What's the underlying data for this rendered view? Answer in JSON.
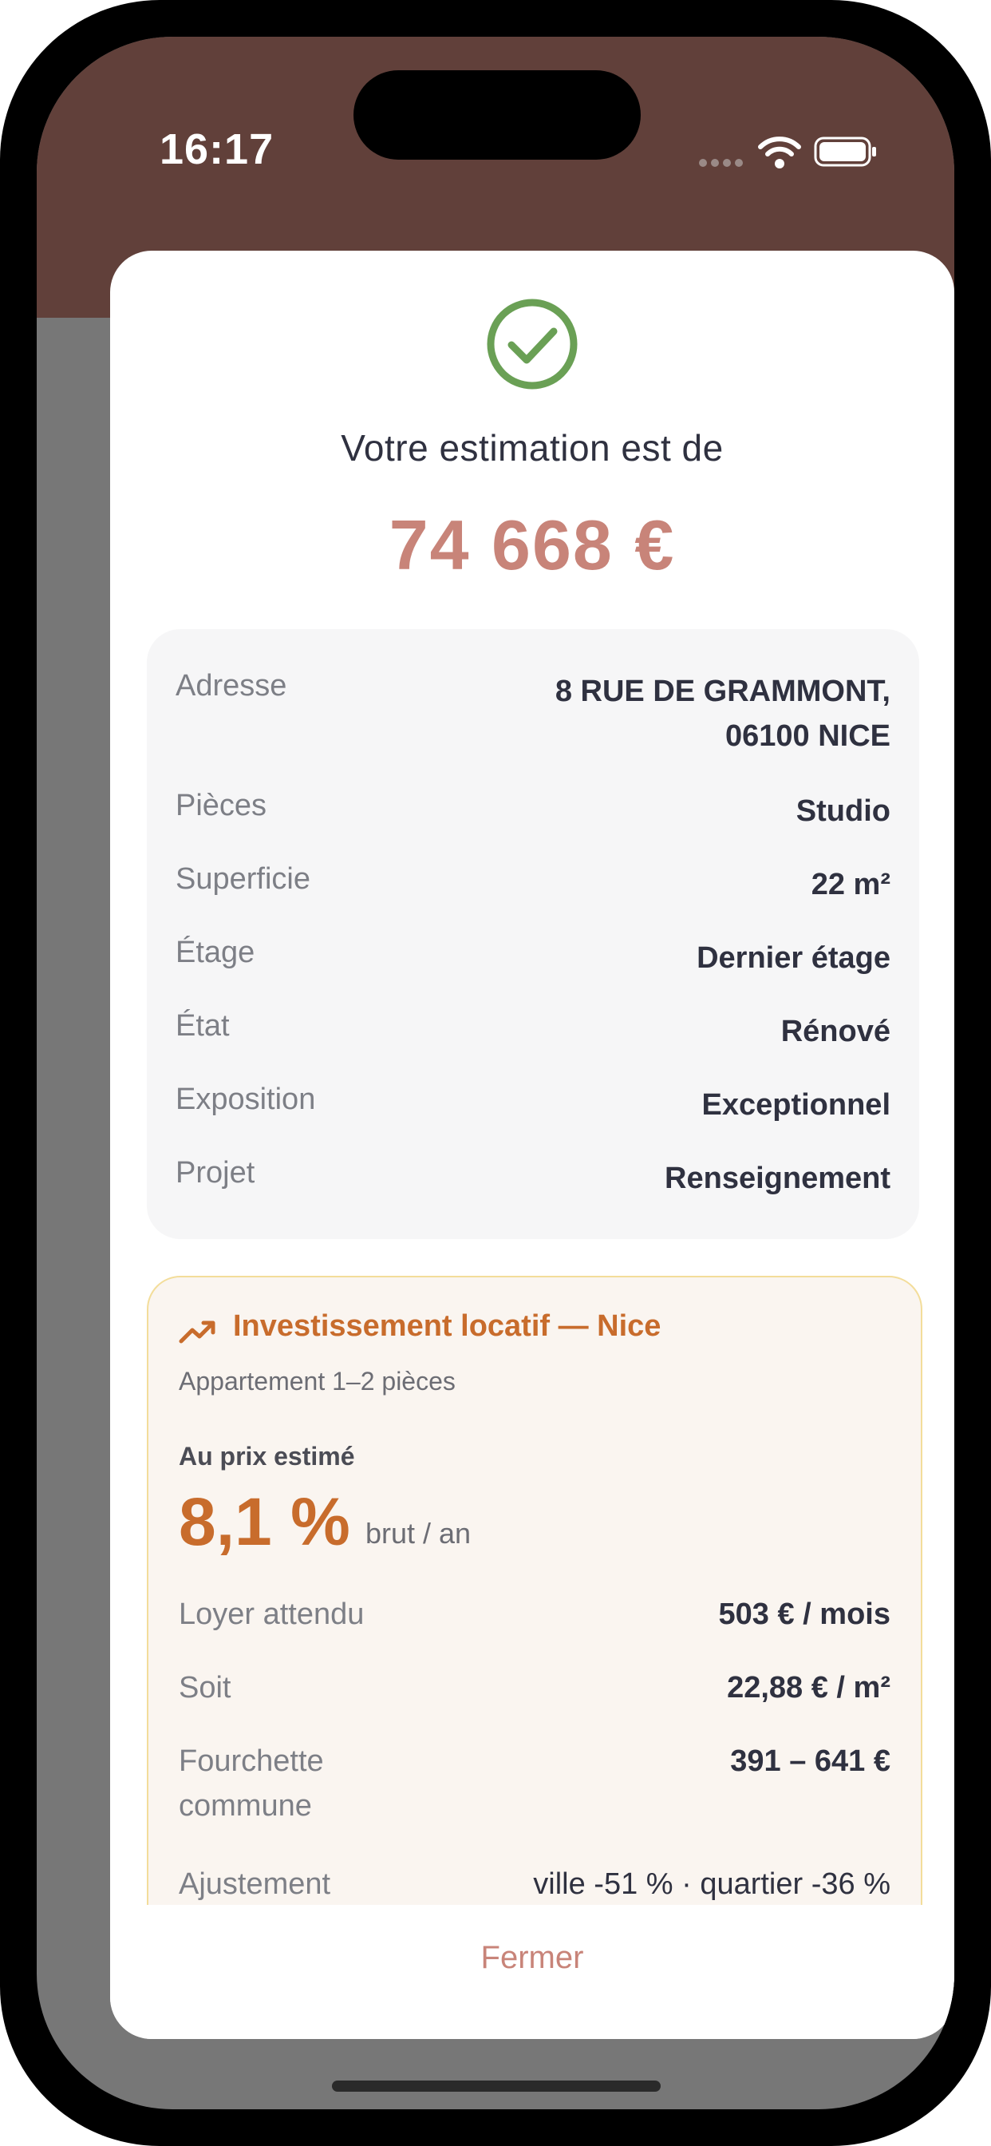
{
  "status_bar": {
    "time": "16:17"
  },
  "header": {
    "intro": "Votre estimation est de",
    "amount": "74 668 €"
  },
  "details": {
    "address_label": "Adresse",
    "address_line1": "8 RUE DE GRAMMONT,",
    "address_line2": "06100 NICE",
    "rooms_label": "Pièces",
    "rooms_value": "Studio",
    "surface_label": "Superficie",
    "surface_value": "22 m²",
    "floor_label": "Étage",
    "floor_value": "Dernier étage",
    "condition_label": "État",
    "condition_value": "Rénové",
    "exposure_label": "Exposition",
    "exposure_value": "Exceptionnel",
    "project_label": "Projet",
    "project_value": "Renseignement"
  },
  "investment": {
    "title": "Investissement locatif — Nice",
    "subtitle": "Appartement 1–2 pièces",
    "at_price_label": "Au prix estimé",
    "yield": "8,1 %",
    "yield_unit": "brut / an",
    "rent_label": "Loyer attendu",
    "rent_value": "503 € / mois",
    "per_m2_label": "Soit",
    "per_m2_value": "22,88 € / m²",
    "range_label_line1": "Fourchette",
    "range_label_line2": "commune",
    "range_value": "391 – 641 €",
    "adjust_label": "Ajustement",
    "adjust_value": "ville -51 % · quartier -36 %"
  },
  "footer": {
    "close_label": "Fermer"
  },
  "icons": {
    "success": "check-circle-icon",
    "trend": "trending-up-icon",
    "wifi": "wifi-icon",
    "battery": "battery-icon"
  },
  "colors": {
    "header_band": "#61403a",
    "amount": "#c88479",
    "success": "#6aa055",
    "accent": "#c86c2c",
    "card_bg": "#f6f6f7",
    "invest_bg": "#faf5f0"
  }
}
